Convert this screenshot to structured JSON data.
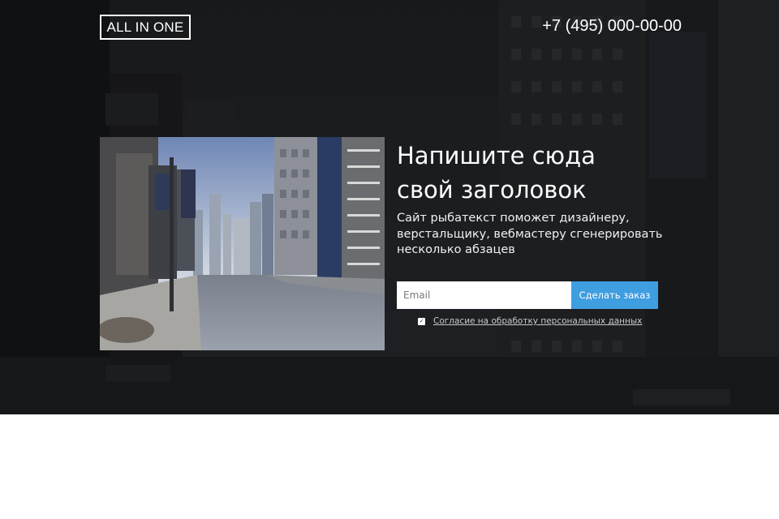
{
  "header": {
    "logo": "ALL IN ONE",
    "phone": "+7 (495) 000-00-00"
  },
  "hero": {
    "title_line1": "Напишите сюда",
    "title_line2": "свой заголовок",
    "subtitle_line1": "Сайт рыбатекст поможет дизайнеру,",
    "subtitle_line2": "верстальщику, вебмастеру сгенерировать",
    "subtitle_line3": "несколько абзацев"
  },
  "form": {
    "email_placeholder": "Email",
    "submit_label": "Сделать заказ",
    "consent_checked": true,
    "consent_label": "Согласие на обработку персональных данных"
  },
  "icons": {
    "checkbox": "checkmark-icon"
  },
  "colors": {
    "accent": "#3e9ee0",
    "overlay": "#000000",
    "text": "#ffffff"
  }
}
